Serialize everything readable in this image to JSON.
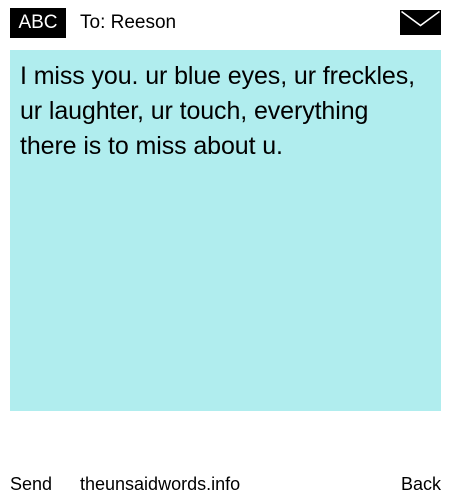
{
  "header": {
    "mode_label": "ABC",
    "recipient": "To: Reeson",
    "icon": "envelope-icon"
  },
  "message": {
    "text": "I miss you. ur blue eyes, ur freckles, ur laughter, ur touch, everything there is to miss about u."
  },
  "footer": {
    "send_label": "Send",
    "site_label": "theunsaidwords.info",
    "back_label": "Back"
  },
  "colors": {
    "message_background": "#b0edee",
    "badge_background": "#000000",
    "badge_text": "#ffffff",
    "text": "#000000"
  }
}
